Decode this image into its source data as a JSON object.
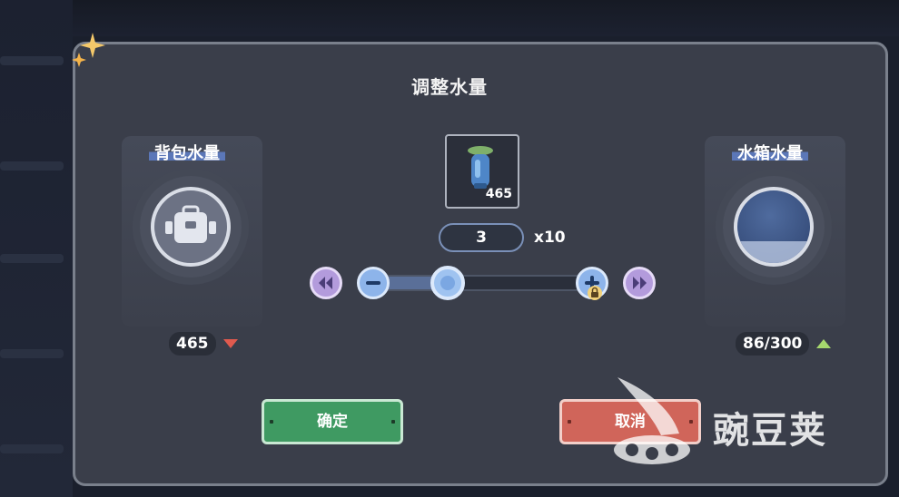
{
  "dialog": {
    "title": "调整水量",
    "backpack": {
      "label": "背包水量",
      "value": "465"
    },
    "tank": {
      "label": "水箱水量",
      "value": "86/300"
    },
    "item": {
      "count": "465",
      "icon": "water-bottle-icon"
    },
    "quantity": {
      "value": "3",
      "multiplier": "x10"
    },
    "slider": {
      "fraction": 0.35
    },
    "buttons": {
      "confirm": "确定",
      "cancel": "取消"
    }
  },
  "watermark": {
    "text": "豌豆荚"
  },
  "colors": {
    "confirm": "#3f9a62",
    "cancel": "#d0655a",
    "decrease_arrow": "#e05a4e",
    "increase_arrow": "#a6d86e",
    "accent_purple": "#b39bdc",
    "accent_blue": "#8db4ea"
  }
}
